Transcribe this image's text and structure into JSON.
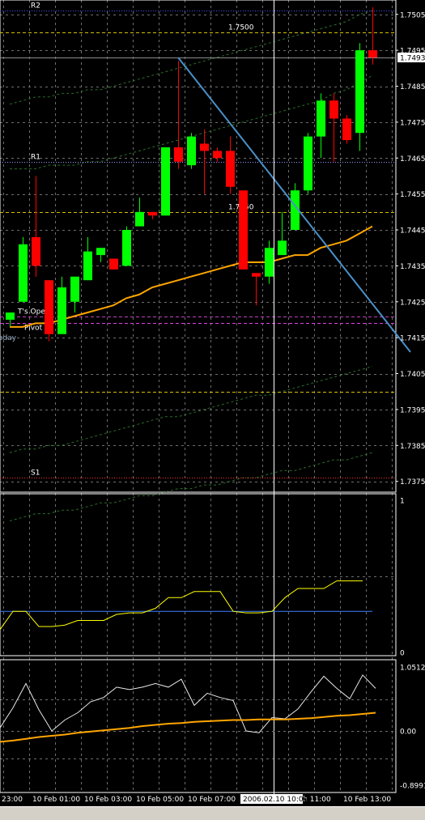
{
  "chart_data": [
    {
      "panel": "main",
      "type": "candlestick",
      "y_ticks": [
        "1.7505",
        "1.7495",
        "1.7485",
        "1.7475",
        "1.7465",
        "1.7455",
        "1.7445",
        "1.7435",
        "1.7425",
        "1.7415",
        "1.7405",
        "1.7395",
        "1.7385",
        "1.7375"
      ],
      "ylim": [
        1.7372,
        1.7509
      ],
      "current_price": "1.7493",
      "candles": [
        {
          "o": 1.742,
          "h": 1.7422,
          "l": 1.7418,
          "c": 1.7422
        },
        {
          "o": 1.7425,
          "h": 1.7443,
          "l": 1.7425,
          "c": 1.7441
        },
        {
          "o": 1.7443,
          "h": 1.746,
          "l": 1.7432,
          "c": 1.7435
        },
        {
          "o": 1.7431,
          "h": 1.7431,
          "l": 1.7414,
          "c": 1.7416
        },
        {
          "o": 1.7416,
          "h": 1.7432,
          "l": 1.7416,
          "c": 1.7429
        },
        {
          "o": 1.7425,
          "h": 1.7432,
          "l": 1.7422,
          "c": 1.7432
        },
        {
          "o": 1.7431,
          "h": 1.7443,
          "l": 1.7431,
          "c": 1.7439
        },
        {
          "o": 1.7438,
          "h": 1.744,
          "l": 1.7436,
          "c": 1.744
        },
        {
          "o": 1.7437,
          "h": 1.7437,
          "l": 1.7434,
          "c": 1.7434
        },
        {
          "o": 1.7435,
          "h": 1.7446,
          "l": 1.7435,
          "c": 1.7445
        },
        {
          "o": 1.7446,
          "h": 1.7454,
          "l": 1.7446,
          "c": 1.745
        },
        {
          "o": 1.745,
          "h": 1.745,
          "l": 1.7448,
          "c": 1.7449
        },
        {
          "o": 1.7449,
          "h": 1.7467,
          "l": 1.7449,
          "c": 1.7468
        },
        {
          "o": 1.7468,
          "h": 1.7492,
          "l": 1.7462,
          "c": 1.7464
        },
        {
          "o": 1.7463,
          "h": 1.7472,
          "l": 1.7462,
          "c": 1.7471
        },
        {
          "o": 1.7469,
          "h": 1.7473,
          "l": 1.7455,
          "c": 1.7467
        },
        {
          "o": 1.7467,
          "h": 1.7468,
          "l": 1.7464,
          "c": 1.7465
        },
        {
          "o": 1.7467,
          "h": 1.7471,
          "l": 1.7455,
          "c": 1.7457
        },
        {
          "o": 1.7456,
          "h": 1.7456,
          "l": 1.7434,
          "c": 1.7434
        },
        {
          "o": 1.7433,
          "h": 1.7433,
          "l": 1.7424,
          "c": 1.7432
        },
        {
          "o": 1.7432,
          "h": 1.7442,
          "l": 1.743,
          "c": 1.744
        },
        {
          "o": 1.7438,
          "h": 1.745,
          "l": 1.7438,
          "c": 1.7442
        },
        {
          "o": 1.7445,
          "h": 1.7458,
          "l": 1.7445,
          "c": 1.7456
        },
        {
          "o": 1.7456,
          "h": 1.7472,
          "l": 1.7455,
          "c": 1.7471
        },
        {
          "o": 1.7471,
          "h": 1.7483,
          "l": 1.7465,
          "c": 1.7481
        },
        {
          "o": 1.7481,
          "h": 1.7483,
          "l": 1.7464,
          "c": 1.7476
        },
        {
          "o": 1.7476,
          "h": 1.7477,
          "l": 1.7469,
          "c": 1.747
        },
        {
          "o": 1.7472,
          "h": 1.7497,
          "l": 1.7467,
          "c": 1.7495
        },
        {
          "o": 1.7495,
          "h": 1.7507,
          "l": 1.7491,
          "c": 1.7493
        }
      ],
      "moving_average": [
        1.7418,
        1.7418,
        1.7419,
        1.7419,
        1.742,
        1.7421,
        1.7422,
        1.7423,
        1.7424,
        1.7426,
        1.7427,
        1.7429,
        1.743,
        1.7431,
        1.7432,
        1.7433,
        1.7434,
        1.7435,
        1.7436,
        1.7436,
        1.7436,
        1.7437,
        1.7438,
        1.7438,
        1.744,
        1.7441,
        1.7442,
        1.7444,
        1.7446
      ],
      "envelope_upper": [
        1.7462,
        1.7462,
        1.7462,
        1.7463,
        1.7463,
        1.7463,
        1.7464,
        1.7464,
        1.7465,
        1.7466,
        1.7467,
        1.7468,
        1.7469,
        1.747,
        1.7471,
        1.7472,
        1.7473,
        1.7474,
        1.7475,
        1.7476,
        1.7477,
        1.7478,
        1.7479,
        1.748,
        1.7481,
        1.7483,
        1.7484,
        1.7486,
        1.7488
      ],
      "envelope_upper2": [
        1.748,
        1.7481,
        1.7482,
        1.7482,
        1.7483,
        1.7483,
        1.7484,
        1.7484,
        1.7485,
        1.7486,
        1.7487,
        1.7488,
        1.7489,
        1.749,
        1.7491,
        1.7492,
        1.7493,
        1.7494,
        1.7495,
        1.7496,
        1.7497,
        1.7498,
        1.7499,
        1.75,
        1.7501,
        1.7502,
        1.7503,
        1.7505,
        1.7506
      ],
      "envelope_lower": [
        1.7383,
        1.7384,
        1.7384,
        1.7385,
        1.7385,
        1.7386,
        1.7387,
        1.7388,
        1.7389,
        1.739,
        1.7391,
        1.7392,
        1.7393,
        1.7393,
        1.7394,
        1.7395,
        1.7396,
        1.7397,
        1.7398,
        1.7399,
        1.7399,
        1.74,
        1.7401,
        1.7402,
        1.7403,
        1.7404,
        1.7405,
        1.7406,
        1.7407
      ],
      "envelope_lower2": [
        1.7364,
        1.7365,
        1.7366,
        1.7366,
        1.7367,
        1.7367,
        1.7368,
        1.7369,
        1.7369,
        1.737,
        1.7371,
        1.7371,
        1.7372,
        1.7373,
        1.7373,
        1.7374,
        1.7374,
        1.7375,
        1.7376,
        1.7376,
        1.7377,
        1.7378,
        1.7378,
        1.7379,
        1.738,
        1.7381,
        1.7381,
        1.7382,
        1.7383
      ],
      "levels": [
        {
          "label": "R2",
          "price": 1.7506,
          "color": "#5050ff",
          "style": "dot"
        },
        {
          "label": "1.7500",
          "price": 1.75,
          "color": "#d4c000",
          "style": "dash"
        },
        {
          "label": "",
          "price": 1.7493,
          "color": "#8c8c8c",
          "style": "solid"
        },
        {
          "label": "R1",
          "price": 1.7464,
          "color": "#9a9aff",
          "style": "dot"
        },
        {
          "label": "1.7450",
          "price": 1.745,
          "color": "#d4c000",
          "style": "dash"
        },
        {
          "label": "T's Open",
          "price": 1.7421,
          "color": "#c040c0",
          "style": "dash"
        },
        {
          "label": "Pivot",
          "price": 1.7419,
          "color": "#e040e0",
          "style": "dash"
        },
        {
          "label": "",
          "price": 1.74,
          "color": "#d4c000",
          "style": "dash"
        },
        {
          "label": "S1",
          "price": 1.7376,
          "color": "#ff3030",
          "style": "dot"
        }
      ],
      "left_edge_label": "oday",
      "trendline": {
        "from": {
          "bar": 13,
          "price": 1.7493
        },
        "to": {
          "bar": 31,
          "price": 1.7411
        }
      },
      "colors": {
        "bull": "#00ff00",
        "bear": "#ff0000",
        "ma": "#ffa500",
        "envelope": "#2a6e2a"
      }
    },
    {
      "panel": "oscillator1",
      "type": "line",
      "y_ticks": [
        "1",
        "0"
      ],
      "ylim": [
        0,
        1
      ],
      "signal_level": 0.27,
      "series": [
        {
          "values": [
            0.15,
            0.27,
            0.27,
            0.17,
            0.17,
            0.18,
            0.21,
            0.21,
            0.21,
            0.25,
            0.26,
            0.26,
            0.29,
            0.36,
            0.36,
            0.4,
            0.4,
            0.4,
            0.27,
            0.26,
            0.26,
            0.27,
            0.36,
            0.42,
            0.42,
            0.42,
            0.47,
            0.47,
            0.47
          ],
          "color": "#ffff00"
        }
      ],
      "signal_color": "#4080ff"
    },
    {
      "panel": "oscillator2",
      "type": "line",
      "y_ticks": [
        "1.05127",
        "0.00",
        "-0.8991"
      ],
      "ylim": [
        -0.9,
        1.07
      ],
      "series": [
        {
          "values": [
            0.05,
            0.38,
            0.78,
            0.35,
            0.0,
            0.18,
            0.3,
            0.48,
            0.55,
            0.72,
            0.68,
            0.72,
            0.78,
            0.72,
            0.85,
            0.42,
            0.62,
            0.55,
            0.5,
            0.0,
            -0.03,
            0.22,
            0.2,
            0.36,
            0.64,
            0.9,
            0.7,
            0.53,
            0.92,
            0.7
          ],
          "color": "#e8e8e8"
        },
        {
          "values": [
            -0.18,
            -0.16,
            -0.13,
            -0.1,
            -0.08,
            -0.06,
            -0.03,
            -0.01,
            0.01,
            0.03,
            0.05,
            0.08,
            0.1,
            0.12,
            0.13,
            0.15,
            0.16,
            0.17,
            0.18,
            0.18,
            0.19,
            0.19,
            0.19,
            0.2,
            0.21,
            0.23,
            0.25,
            0.26,
            0.28,
            0.3
          ],
          "color": "#ffa500"
        }
      ]
    }
  ],
  "time_axis": {
    "labels": [
      "23:00",
      "10 Feb 01:00",
      "10 Feb 03:00",
      "10 Feb 05:00",
      "10 Feb 07:00",
      "Feb 11:00",
      "10 Feb 13:00"
    ],
    "cursor_label": "2006.02.10 10:00"
  }
}
